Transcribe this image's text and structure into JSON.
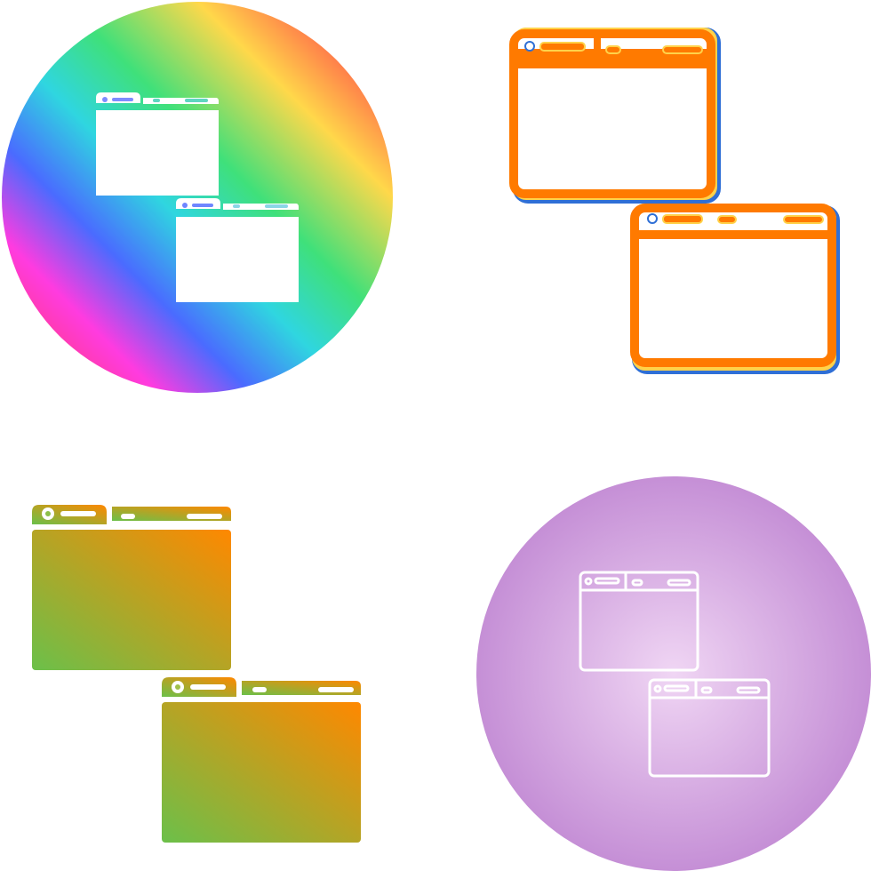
{
  "icon_set": [
    {
      "icon": "windows-icon",
      "style": "gradient-circle",
      "colors": [
        "#ff3b3b",
        "#ffe24a",
        "#39d67a",
        "#3b6bff",
        "#ff3bd6",
        "#ff3b6b"
      ]
    },
    {
      "icon": "windows-icon",
      "style": "outline-offset",
      "colors": [
        "#ff7a00",
        "#2f6fd6",
        "#ffd24a"
      ]
    },
    {
      "icon": "windows-icon",
      "style": "gradient-glyph",
      "colors": [
        "#6bc04a",
        "#ff8a00"
      ]
    },
    {
      "icon": "windows-icon",
      "style": "line-on-circle",
      "colors": [
        "#e9c6ef",
        "#c58fd6",
        "#ffffff"
      ]
    }
  ]
}
